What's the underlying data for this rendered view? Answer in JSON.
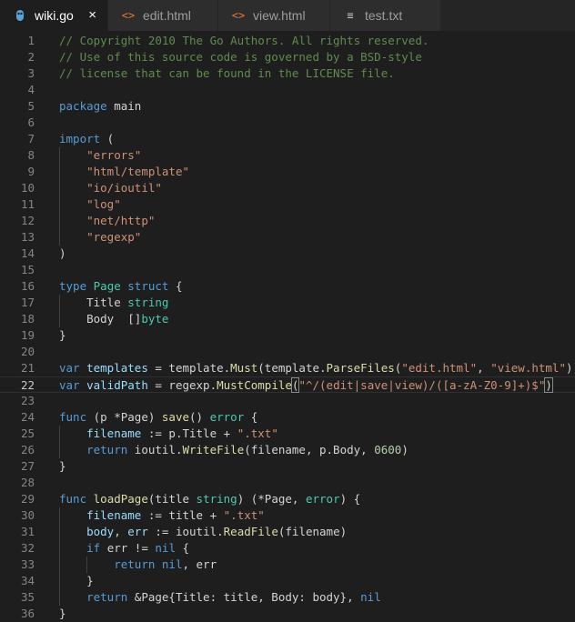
{
  "tabs": [
    {
      "label": "wiki.go",
      "icon": "go-file-icon",
      "active": true,
      "close": "×"
    },
    {
      "label": "edit.html",
      "icon": "html-file-icon",
      "glyph": "<>"
    },
    {
      "label": "view.html",
      "icon": "html-file-icon",
      "glyph": "<>"
    },
    {
      "label": "test.txt",
      "icon": "text-file-icon",
      "glyph": "≡"
    }
  ],
  "colors": {
    "comment": "#608b4e",
    "keyword": "#569cd6",
    "string": "#ce9178",
    "function": "#dcdcaa",
    "type": "#4ec9b0",
    "number": "#b5cea8"
  },
  "current_line": 22,
  "lines": [
    [
      [
        "c",
        "// Copyright 2010 The Go Authors. All rights reserved."
      ]
    ],
    [
      [
        "c",
        "// Use of this source code is governed by a BSD-style"
      ]
    ],
    [
      [
        "c",
        "// license that can be found in the LICENSE file."
      ]
    ],
    [],
    [
      [
        "k",
        "package"
      ],
      [
        "p",
        " main"
      ]
    ],
    [],
    [
      [
        "k",
        "import"
      ],
      [
        "p",
        " ("
      ]
    ],
    [
      [
        "p",
        "    "
      ],
      [
        "s",
        "\"errors\""
      ]
    ],
    [
      [
        "p",
        "    "
      ],
      [
        "s",
        "\"html/template\""
      ]
    ],
    [
      [
        "p",
        "    "
      ],
      [
        "s",
        "\"io/ioutil\""
      ]
    ],
    [
      [
        "p",
        "    "
      ],
      [
        "s",
        "\"log\""
      ]
    ],
    [
      [
        "p",
        "    "
      ],
      [
        "s",
        "\"net/http\""
      ]
    ],
    [
      [
        "p",
        "    "
      ],
      [
        "s",
        "\"regexp\""
      ]
    ],
    [
      [
        "p",
        ")"
      ]
    ],
    [],
    [
      [
        "k",
        "type"
      ],
      [
        "p",
        " "
      ],
      [
        "t",
        "Page"
      ],
      [
        "p",
        " "
      ],
      [
        "k",
        "struct"
      ],
      [
        "p",
        " {"
      ]
    ],
    [
      [
        "p",
        "    Title "
      ],
      [
        "t",
        "string"
      ]
    ],
    [
      [
        "p",
        "    Body  []"
      ],
      [
        "t",
        "byte"
      ]
    ],
    [
      [
        "p",
        "}"
      ]
    ],
    [],
    [
      [
        "k",
        "var"
      ],
      [
        "p",
        " "
      ],
      [
        "v",
        "templates"
      ],
      [
        "p",
        " = template."
      ],
      [
        "f",
        "Must"
      ],
      [
        "p",
        "(template."
      ],
      [
        "f",
        "ParseFiles"
      ],
      [
        "p",
        "("
      ],
      [
        "s",
        "\"edit.html\""
      ],
      [
        "p",
        ", "
      ],
      [
        "s",
        "\"view.html\""
      ],
      [
        "p",
        "))"
      ]
    ],
    [
      [
        "k",
        "var"
      ],
      [
        "p",
        " "
      ],
      [
        "v",
        "validPath"
      ],
      [
        "p",
        " = regexp."
      ],
      [
        "f",
        "MustCompile"
      ],
      [
        "b",
        "("
      ],
      [
        "s",
        "\"^/(edit|save|view)/([a-zA-Z0-9]+)$\""
      ],
      [
        "b",
        ")"
      ]
    ],
    [],
    [
      [
        "k",
        "func"
      ],
      [
        "p",
        " (p *Page) "
      ],
      [
        "f",
        "save"
      ],
      [
        "p",
        "() "
      ],
      [
        "t",
        "error"
      ],
      [
        "p",
        " {"
      ]
    ],
    [
      [
        "p",
        "    "
      ],
      [
        "v",
        "filename"
      ],
      [
        "p",
        " := p.Title + "
      ],
      [
        "s",
        "\".txt\""
      ]
    ],
    [
      [
        "p",
        "    "
      ],
      [
        "k",
        "return"
      ],
      [
        "p",
        " ioutil."
      ],
      [
        "f",
        "WriteFile"
      ],
      [
        "p",
        "(filename, p.Body, "
      ],
      [
        "n",
        "0600"
      ],
      [
        "p",
        ")"
      ]
    ],
    [
      [
        "p",
        "}"
      ]
    ],
    [],
    [
      [
        "k",
        "func"
      ],
      [
        "p",
        " "
      ],
      [
        "f",
        "loadPage"
      ],
      [
        "p",
        "(title "
      ],
      [
        "t",
        "string"
      ],
      [
        "p",
        ") (*Page, "
      ],
      [
        "t",
        "error"
      ],
      [
        "p",
        ") {"
      ]
    ],
    [
      [
        "p",
        "    "
      ],
      [
        "v",
        "filename"
      ],
      [
        "p",
        " := title + "
      ],
      [
        "s",
        "\".txt\""
      ]
    ],
    [
      [
        "p",
        "    "
      ],
      [
        "v",
        "body"
      ],
      [
        "p",
        ", "
      ],
      [
        "v",
        "err"
      ],
      [
        "p",
        " := ioutil."
      ],
      [
        "f",
        "ReadFile"
      ],
      [
        "p",
        "(filename)"
      ]
    ],
    [
      [
        "p",
        "    "
      ],
      [
        "k",
        "if"
      ],
      [
        "p",
        " err != "
      ],
      [
        "k",
        "nil"
      ],
      [
        "p",
        " {"
      ]
    ],
    [
      [
        "p",
        "        "
      ],
      [
        "k",
        "return"
      ],
      [
        "p",
        " "
      ],
      [
        "k",
        "nil"
      ],
      [
        "p",
        ", err"
      ]
    ],
    [
      [
        "p",
        "    }"
      ]
    ],
    [
      [
        "p",
        "    "
      ],
      [
        "k",
        "return"
      ],
      [
        "p",
        " &Page{Title: title, Body: body}, "
      ],
      [
        "k",
        "nil"
      ]
    ],
    [
      [
        "p",
        "}"
      ]
    ]
  ]
}
